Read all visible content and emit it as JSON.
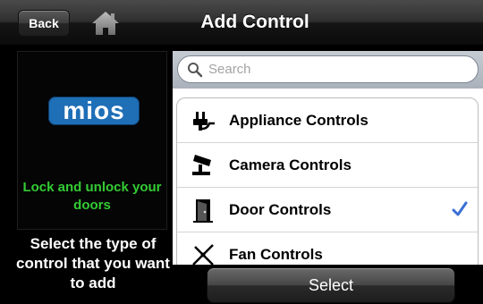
{
  "navbar": {
    "back_label": "Back",
    "title": "Add Control",
    "home_icon": "home-icon"
  },
  "promo": {
    "logo_text": "mios",
    "tagline": "Lock and unlock your doors",
    "tagline_color": "#33cc33",
    "logo_color": "#1f6fb7"
  },
  "instructions": "Select the type of control that you want to add",
  "search": {
    "placeholder": "Search",
    "icon": "search-icon"
  },
  "controls": [
    {
      "label": "Appliance Controls",
      "icon": "plug-icon",
      "selected": false
    },
    {
      "label": "Camera Controls",
      "icon": "camera-icon",
      "selected": false
    },
    {
      "label": "Door Controls",
      "icon": "door-icon",
      "selected": true
    },
    {
      "label": "Fan Controls",
      "icon": "fan-icon",
      "selected": false
    }
  ],
  "check_color": "#3b6fd3",
  "select_label": "Select"
}
